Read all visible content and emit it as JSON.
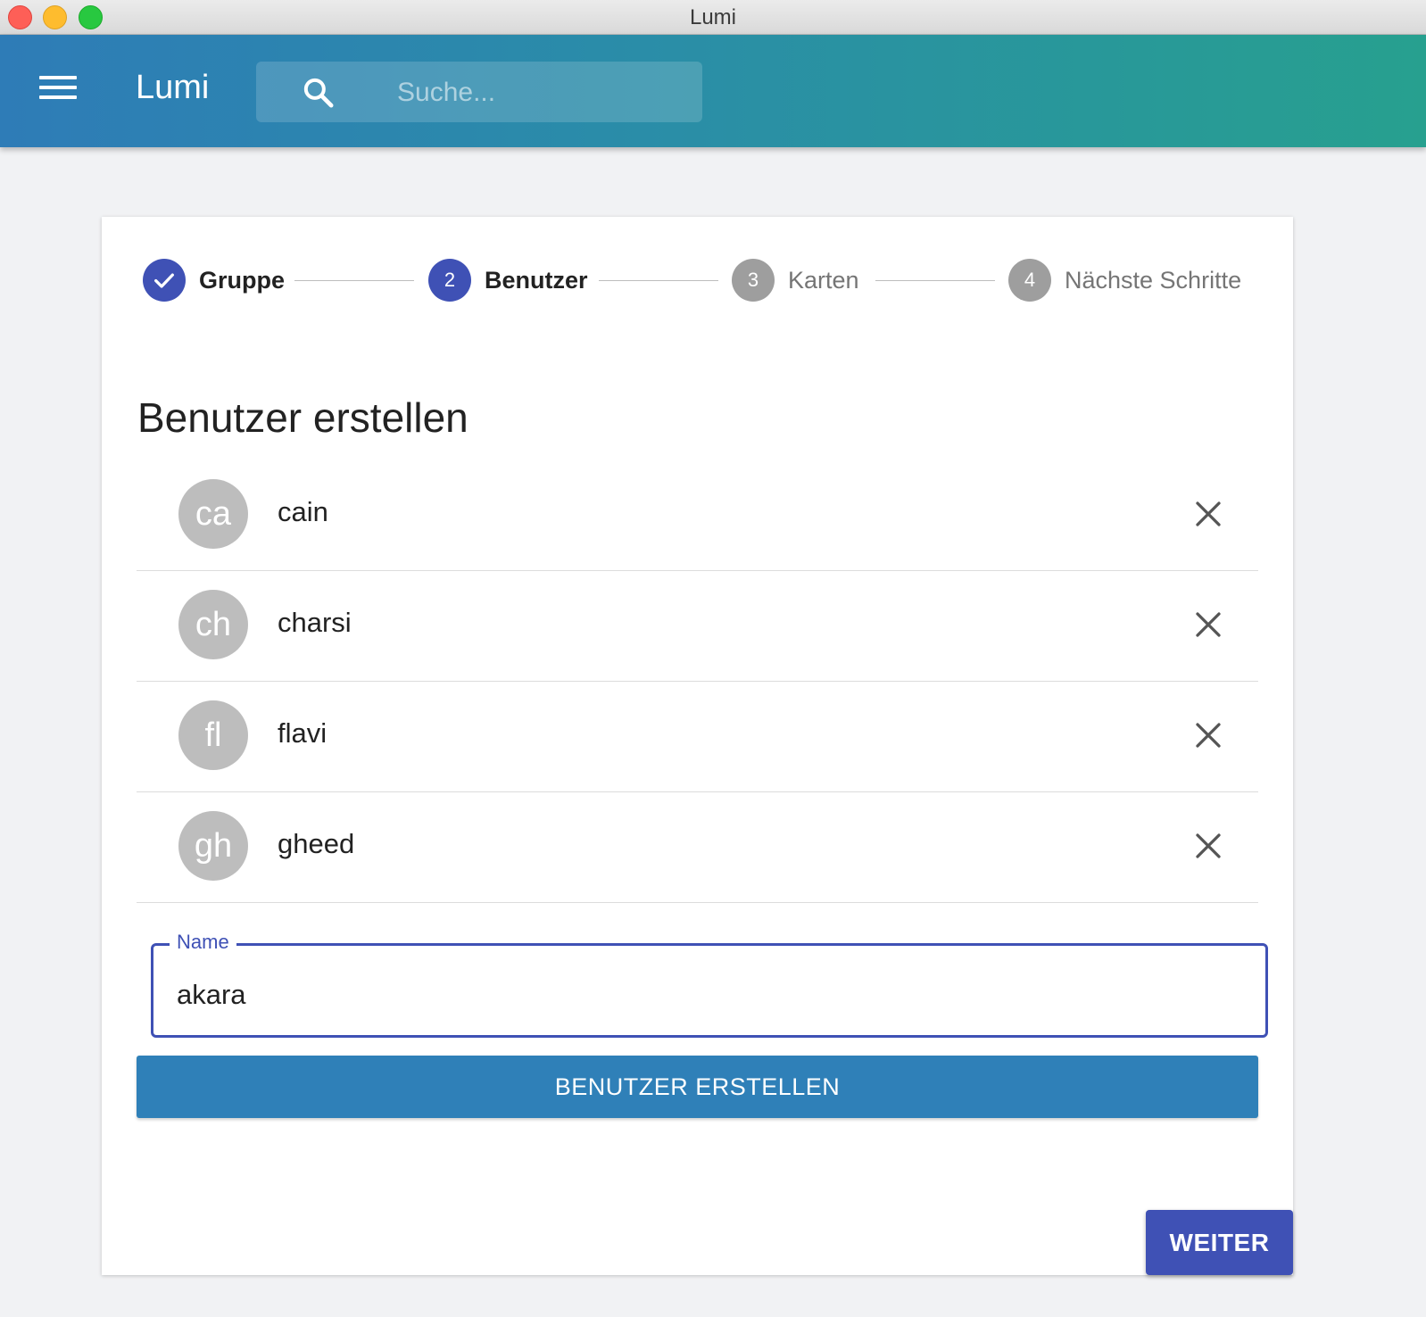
{
  "window": {
    "title": "Lumi"
  },
  "appbar": {
    "title": "Lumi",
    "search_placeholder": "Suche..."
  },
  "stepper": {
    "steps": [
      {
        "number": "1",
        "label": "Gruppe",
        "state": "completed"
      },
      {
        "number": "2",
        "label": "Benutzer",
        "state": "active"
      },
      {
        "number": "3",
        "label": "Karten",
        "state": "inactive"
      },
      {
        "number": "4",
        "label": "Nächste Schritte",
        "state": "inactive"
      }
    ]
  },
  "main": {
    "title": "Benutzer erstellen",
    "users": [
      {
        "initials": "ca",
        "name": "cain"
      },
      {
        "initials": "ch",
        "name": "charsi"
      },
      {
        "initials": "fl",
        "name": "flavi"
      },
      {
        "initials": "gh",
        "name": "gheed"
      }
    ],
    "name_field": {
      "label": "Name",
      "value": "akara"
    },
    "create_button": "BENUTZER ERSTELLEN",
    "next_button": "WEITER"
  },
  "colors": {
    "primary": "#3f51b5",
    "appbar_start": "#2e7cb7",
    "appbar_end": "#27a08f",
    "create_button": "#2f80b8",
    "avatar": "#bdbdbd"
  },
  "icons": {
    "menu": "menu-icon",
    "search": "search-icon",
    "check": "check-icon",
    "delete": "close-icon"
  }
}
